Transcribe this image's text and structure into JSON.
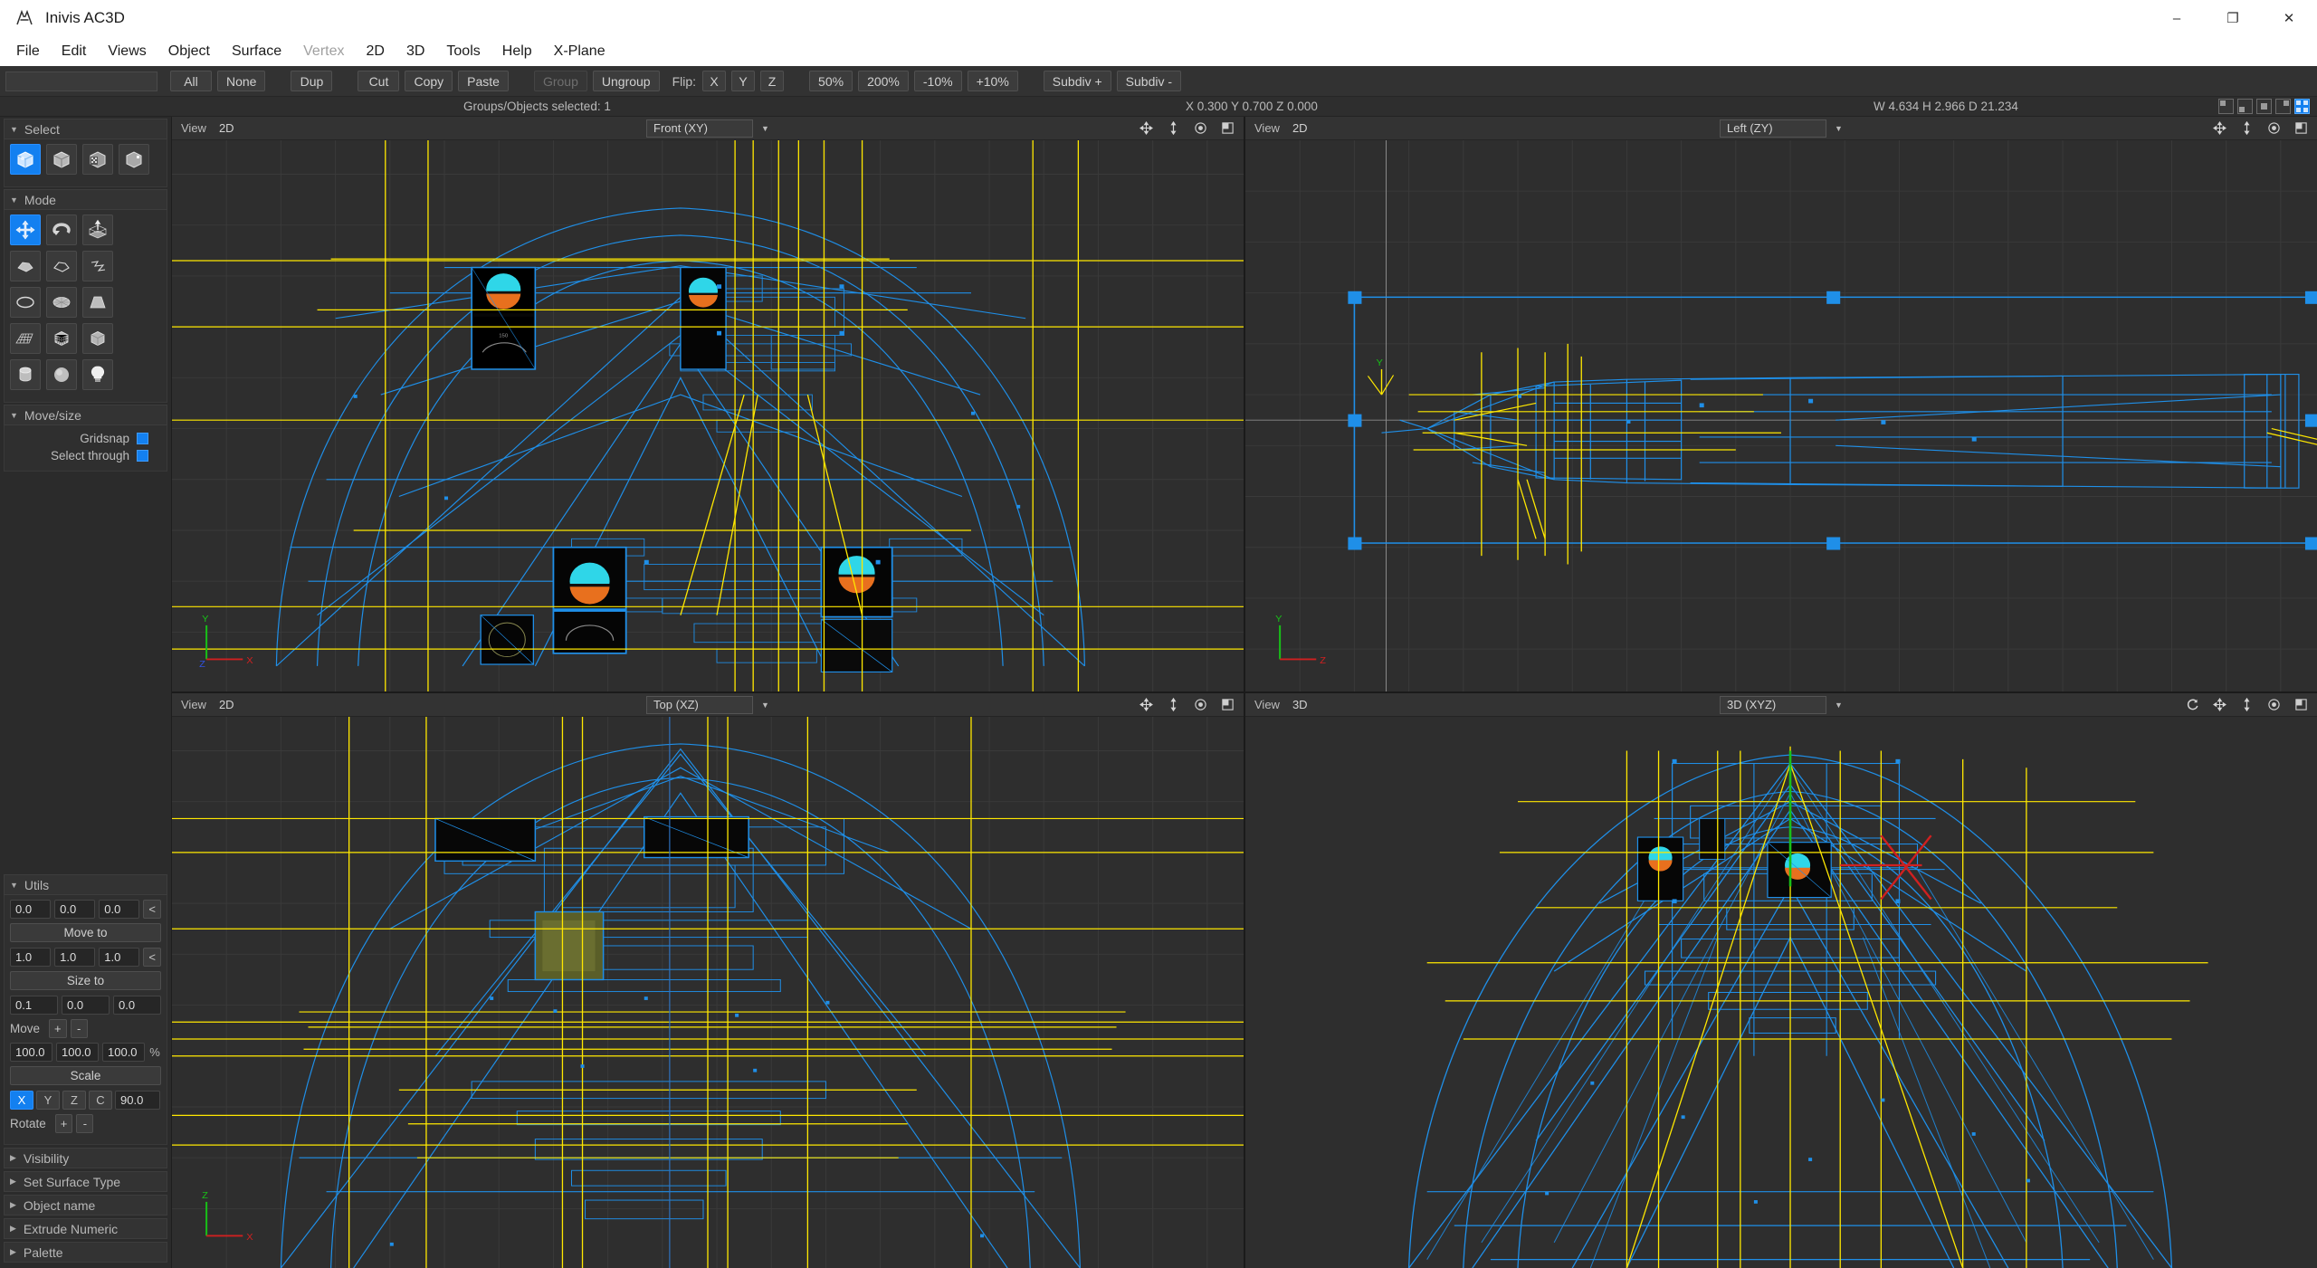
{
  "window": {
    "title": "Inivis AC3D",
    "app_icon": "ac3d-logo-icon",
    "controls": [
      {
        "name": "minimize-button",
        "glyph": "–"
      },
      {
        "name": "maximize-button",
        "glyph": "❐"
      },
      {
        "name": "close-button",
        "glyph": "✕"
      }
    ]
  },
  "menubar": {
    "items": [
      {
        "label": "File",
        "disabled": false
      },
      {
        "label": "Edit",
        "disabled": false
      },
      {
        "label": "Views",
        "disabled": false
      },
      {
        "label": "Object",
        "disabled": false
      },
      {
        "label": "Surface",
        "disabled": false
      },
      {
        "label": "Vertex",
        "disabled": true
      },
      {
        "label": "2D",
        "disabled": false
      },
      {
        "label": "3D",
        "disabled": false
      },
      {
        "label": "Tools",
        "disabled": false
      },
      {
        "label": "Help",
        "disabled": false
      },
      {
        "label": "X-Plane",
        "disabled": false
      }
    ]
  },
  "toolbar": {
    "all_label": "All",
    "none_label": "None",
    "dup_label": "Dup",
    "cut_label": "Cut",
    "copy_label": "Copy",
    "paste_label": "Paste",
    "group_label": "Group",
    "ungroup_label": "Ungroup",
    "flip_label": "Flip:",
    "flip_x_label": "X",
    "flip_y_label": "Y",
    "flip_z_label": "Z",
    "zoom50_label": "50%",
    "zoom200_label": "200%",
    "zoom_minus10_label": "-10%",
    "zoom_plus10_label": "+10%",
    "subdiv_plus_label": "Subdiv +",
    "subdiv_minus_label": "Subdiv -"
  },
  "status": {
    "selection": "Groups/Objects selected: 1",
    "coords": "X 0.300 Y 0.700 Z 0.000",
    "dimensions": "W 4.634 H 2.966 D 21.234"
  },
  "layout_buttons": [
    {
      "name": "layout-single-topleft",
      "active": false
    },
    {
      "name": "layout-single-bottomleft",
      "active": false
    },
    {
      "name": "layout-single-center",
      "active": false
    },
    {
      "name": "layout-single-topright",
      "active": false
    },
    {
      "name": "layout-quad",
      "active": true
    }
  ],
  "sidebar": {
    "select_panel": {
      "title": "Select",
      "expanded": true,
      "icons": [
        {
          "name": "select-object-icon",
          "selected": true
        },
        {
          "name": "select-group-icon",
          "selected": false
        },
        {
          "name": "select-surface-icon",
          "selected": false
        },
        {
          "name": "select-vertex-icon",
          "selected": false
        }
      ]
    },
    "mode_panel": {
      "title": "Mode",
      "expanded": true,
      "icons": [
        {
          "name": "move-tool-icon",
          "selected": true
        },
        {
          "name": "rotate-tool-icon",
          "selected": false
        },
        {
          "name": "scale-tool-icon",
          "selected": false
        },
        {
          "name": "extrude-tool-icon",
          "selected": false
        },
        {
          "name": "polygon-outline-icon",
          "selected": false
        },
        {
          "name": "polyline-icon",
          "selected": false
        },
        {
          "name": "ellipse-primitive-icon",
          "selected": false
        },
        {
          "name": "disc-primitive-icon",
          "selected": false
        },
        {
          "name": "cone-primitive-icon",
          "selected": false
        },
        {
          "name": "grid-primitive-icon",
          "selected": false
        },
        {
          "name": "subdivided-cube-icon",
          "selected": false
        },
        {
          "name": "box-primitive-icon",
          "selected": false
        },
        {
          "name": "cylinder-primitive-icon",
          "selected": false
        },
        {
          "name": "sphere-primitive-icon",
          "selected": false
        },
        {
          "name": "light-primitive-icon",
          "selected": false
        }
      ]
    },
    "movesize_panel": {
      "title": "Move/size",
      "expanded": true,
      "gridsnap_label": "Gridsnap",
      "gridsnap_checked": true,
      "selectthrough_label": "Select through",
      "selectthrough_checked": true
    },
    "utils_panel": {
      "title": "Utils",
      "expanded": true,
      "moveto_values": [
        "0.0",
        "0.0",
        "0.0"
      ],
      "moveto_pick_label": "<",
      "moveto_label": "Move to",
      "sizeto_values": [
        "1.0",
        "1.0",
        "1.0"
      ],
      "sizeto_pick_label": "<",
      "sizeto_label": "Size to",
      "move_values": [
        "0.1",
        "0.0",
        "0.0"
      ],
      "move_label": "Move",
      "move_plus_label": "+",
      "move_minus_label": "-",
      "scale_values": [
        "100.0",
        "100.0",
        "100.0"
      ],
      "scale_unit": "%",
      "scale_label": "Scale",
      "rotate_axes": [
        {
          "label": "X",
          "selected": true
        },
        {
          "label": "Y",
          "selected": false
        },
        {
          "label": "Z",
          "selected": false
        },
        {
          "label": "C",
          "selected": false
        }
      ],
      "rotate_angle": "90.0",
      "rotate_label": "Rotate",
      "rotate_plus_label": "+",
      "rotate_minus_label": "-"
    },
    "collapsed_panels": [
      {
        "title": "Visibility",
        "name": "panel-visibility"
      },
      {
        "title": "Set Surface Type",
        "name": "panel-set-surface-type"
      },
      {
        "title": "Object name",
        "name": "panel-object-name"
      },
      {
        "title": "Extrude Numeric",
        "name": "panel-extrude-numeric"
      },
      {
        "title": "Palette",
        "name": "panel-palette"
      }
    ]
  },
  "viewports": [
    {
      "name": "viewport-front",
      "view_label": "View",
      "mode": "2D",
      "projection": "Front (XY)",
      "has_refresh": false,
      "active": false,
      "icons": [
        "pan-icon",
        "zoom-fit-icon",
        "eye-icon",
        "maximize-icon"
      ]
    },
    {
      "name": "viewport-left",
      "view_label": "View",
      "mode": "2D",
      "projection": "Left (ZY)",
      "has_refresh": false,
      "active": false,
      "icons": [
        "pan-icon",
        "zoom-fit-icon",
        "eye-icon",
        "maximize-icon"
      ]
    },
    {
      "name": "viewport-top",
      "view_label": "View",
      "mode": "2D",
      "projection": "Top (XZ)",
      "has_refresh": false,
      "active": false,
      "icons": [
        "pan-icon",
        "zoom-fit-icon",
        "eye-icon",
        "maximize-icon"
      ]
    },
    {
      "name": "viewport-3d",
      "view_label": "View",
      "mode": "3D",
      "projection": "3D (XYZ)",
      "has_refresh": true,
      "active": true,
      "icons": [
        "refresh-icon",
        "pan-icon",
        "zoom-fit-icon",
        "eye-icon",
        "maximize-icon"
      ]
    }
  ],
  "colors": {
    "wireframe_blue": "#1f8fe8",
    "selection_yellow": "#ffe800",
    "axis_x_red": "#d02020",
    "axis_y_green": "#18c018",
    "axis_z_blue": "#3050e0",
    "accent_blue": "#1380f0",
    "viewport_bg": "#2e2e2e",
    "panel_bg": "#2b2b2b"
  },
  "axis_gizmo": {
    "x_label": "X",
    "y_label": "Y",
    "z_label": "Z"
  }
}
